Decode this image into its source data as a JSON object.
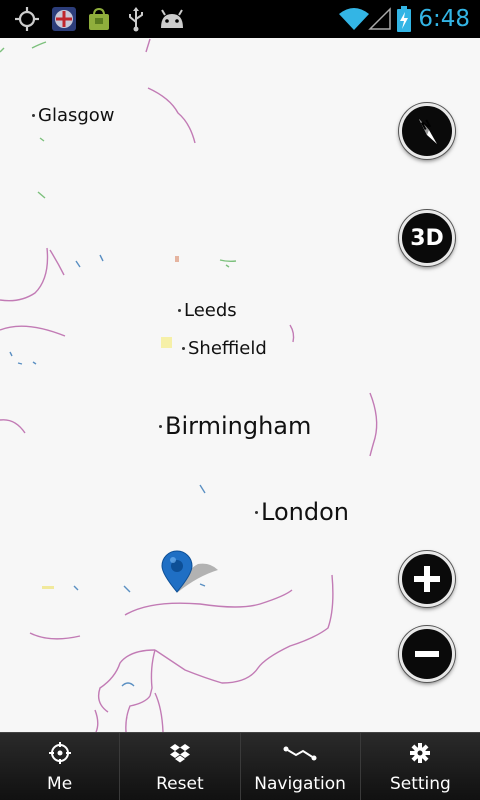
{
  "status_bar": {
    "icons": [
      "gps-icon",
      "app-thumbnail-icon",
      "shopping-bag-icon",
      "usb-icon",
      "android-debug-icon",
      "wifi-icon",
      "signal-icon",
      "battery-charging-icon"
    ],
    "time": "6:48",
    "accent_color": "#33b5e5"
  },
  "map": {
    "cities": [
      {
        "name": "Glasgow"
      },
      {
        "name": "Leeds"
      },
      {
        "name": "Sheffield"
      },
      {
        "name": "Birmingham"
      },
      {
        "name": "London"
      }
    ],
    "compass_icon": "compass-icon",
    "mode_button_label": "3D",
    "zoom_in_icon": "plus-icon",
    "zoom_out_icon": "minus-icon",
    "marker_icon": "location-pin-icon"
  },
  "bottom_bar": {
    "tabs": [
      {
        "label": "Me",
        "icon": "crosshair-icon"
      },
      {
        "label": "Reset",
        "icon": "dropbox-icon"
      },
      {
        "label": "Navigation",
        "icon": "route-icon"
      },
      {
        "label": "Setting",
        "icon": "gear-icon"
      }
    ]
  }
}
